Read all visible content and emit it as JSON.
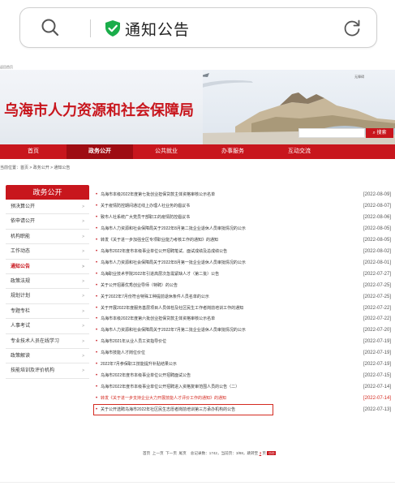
{
  "browser": {
    "page_title": "通知公告"
  },
  "site": {
    "top_small": "返回首页",
    "fav_links": "无障碍",
    "brand": "乌海市人力资源和社会保障局",
    "search_button": "搜索"
  },
  "nav": {
    "items": [
      "首页",
      "政务公开",
      "公共就业",
      "办事服务",
      "互动交流"
    ],
    "active": 1
  },
  "breadcrumb": "当前位置：首页 > 政务公开 > 通知公告",
  "sidebar": {
    "title": "政务公开",
    "items": [
      "预决算公开",
      "依申请公开",
      "机构职能",
      "工作动态",
      "通知公告",
      "政策法规",
      "规划计划",
      "专题专栏",
      "人事考试",
      "专业技术人员在线学习",
      "政策解读",
      "技能培训及评价机构"
    ],
    "active_index": 4
  },
  "notices": [
    {
      "title": "乌海市本级2022年度第七批创业担保贷款主体资格审核公示名单",
      "date": "[2022-08-09]"
    },
    {
      "title": "关于疫情防控期间通过线上办理人社业务的倡议书",
      "date": "[2022-08-07]"
    },
    {
      "title": "致市人社系统广大党员干部职工的疫情防控倡议书",
      "date": "[2022-08-06]"
    },
    {
      "title": "乌海市人力资源和社会保障局关于2022年8月第二批企业退休人员审批情况的公示",
      "date": "[2022-08-05]"
    },
    {
      "title": "转发《关于进一步加强全区专项职业能力考核工作的通知》的通知",
      "date": "[2022-08-05]"
    },
    {
      "title": "乌海市2022年度市本级事业单位公开招聘笔试、面试成绩及总成绩公告",
      "date": "[2022-08-02]"
    },
    {
      "title": "乌海市人力资源和社会保障局关于2022年8月第一批企业退休人员审批情况的公示",
      "date": "[2022-08-01]"
    },
    {
      "title": "乌海职业技术学院2022年引进高层次急需紧缺人才（第二批）公告",
      "date": "[2022-07-27]"
    },
    {
      "title": "关于公开招募优秀创业导师（特聘）的公告",
      "date": "[2022-07-25]"
    },
    {
      "title": "关于2022年7月份符合特殊工种提前退休条件人员名单的公示",
      "date": "[2022-07-25]"
    },
    {
      "title": "关于开展2022年度服务基层项目人员体检及社区民生工作者岗前培训工作的通知",
      "date": "[2022-07-22]"
    },
    {
      "title": "乌海市本级2022年度第六批创业担保贷款主体资格审核公示名单",
      "date": "[2022-07-22]"
    },
    {
      "title": "乌海市人力资源和社会保障局关于2022年7月第二批企业退休人员审批情况的公示",
      "date": "[2022-07-20]"
    },
    {
      "title": "乌海市2021年从业人员工资指导价位",
      "date": "[2022-07-19]"
    },
    {
      "title": "乌海市技能人才岗位价位",
      "date": "[2022-07-19]"
    },
    {
      "title": "2022年7月参保职工技能提升补贴结果公示",
      "date": "[2022-07-19]"
    },
    {
      "title": "乌海市2022年度市本级事业单位公开招聘面试公告",
      "date": "[2022-07-15]"
    },
    {
      "title": "乌海市2022年度市本级事业单位公开招聘进入资格复审范围人员的公告（二）",
      "date": "[2022-07-14]"
    },
    {
      "title": "转发《关于进一步支持企业大力开展技能人才评价工作的通知》的通知",
      "date": "[2022-07-14]",
      "highlight": true
    },
    {
      "title": "关于公开选聘乌海市2022年社区民生志愿者岗前培训第三方承办机构的公告",
      "date": "[2022-07-13]"
    }
  ],
  "pager": {
    "first": "首页",
    "prev": "上一页",
    "next": "下一页",
    "last": "尾页",
    "summary": "总记录数：1742，当前页：3/88，跳转至",
    "page_input": "3",
    "page_unit": "页",
    "go": "GO"
  },
  "colors": {
    "brand_red": "#c8161d",
    "highlight_border": "#d42a20",
    "shield_green": "#1aad4a"
  }
}
